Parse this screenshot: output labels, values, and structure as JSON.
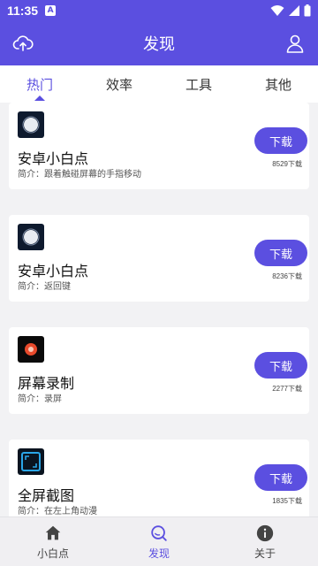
{
  "status": {
    "time": "11:35",
    "notif_letter": "A"
  },
  "app_bar": {
    "title": "发现"
  },
  "tabs": [
    {
      "label": "热门",
      "active": true
    },
    {
      "label": "效率",
      "active": false
    },
    {
      "label": "工具",
      "active": false
    },
    {
      "label": "其他",
      "active": false
    }
  ],
  "apps": [
    {
      "name": "安卓小白点",
      "desc": "简介：跟着触碰屏幕的手指移动",
      "button": "下载",
      "downloads": "8529下载",
      "icon": "white-dot-icon"
    },
    {
      "name": "安卓小白点",
      "desc": "简介：返回键",
      "button": "下载",
      "downloads": "8236下载",
      "icon": "white-dot-icon"
    },
    {
      "name": "屏幕录制",
      "desc": "简介：录屏",
      "button": "下载",
      "downloads": "2277下载",
      "icon": "screen-record-icon"
    },
    {
      "name": "全屏截图",
      "desc": "简介：在左上角动漫",
      "button": "下载",
      "downloads": "1835下载",
      "icon": "screenshot-frame-icon"
    }
  ],
  "bottom_nav": [
    {
      "label": "小白点",
      "icon": "home-icon",
      "active": false
    },
    {
      "label": "发现",
      "icon": "discover-icon",
      "active": true
    },
    {
      "label": "关于",
      "icon": "info-icon",
      "active": false
    }
  ],
  "colors": {
    "accent": "#5b4fe0",
    "background": "#f2f2f4"
  }
}
